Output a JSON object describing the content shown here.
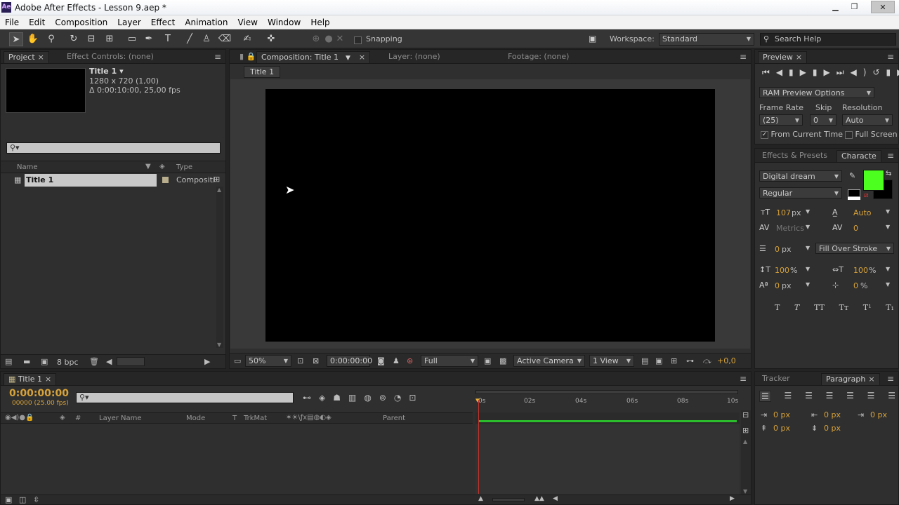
{
  "app": {
    "title": "Adobe After Effects - Lesson 9.aep *",
    "logo_text": "Ae"
  },
  "menu": [
    "File",
    "Edit",
    "Composition",
    "Layer",
    "Effect",
    "Animation",
    "View",
    "Window",
    "Help"
  ],
  "toolbar": {
    "snapping_label": "Snapping",
    "workspace_label": "Workspace:",
    "workspace_value": "Standard",
    "search_placeholder": "Search Help"
  },
  "project_panel": {
    "tab_project": "Project",
    "tab_effect_controls": "Effect Controls: (none)",
    "item_title": "Title 1 ▾",
    "item_dims": "1280 x 720 (1,00)",
    "item_duration": "Δ 0:00:10:00, 25,00 fps",
    "search_icon_text": "⚲▾",
    "col_name": "Name",
    "col_type": "Type",
    "rows": [
      {
        "name": "Title 1",
        "type": "Compositi"
      }
    ],
    "bpc": "8 bpc"
  },
  "comp_panel": {
    "tab_composition": "Composition: Title 1",
    "tab_layer": "Layer: (none)",
    "tab_footage": "Footage: (none)",
    "breadcrumb": "Title 1",
    "zoom": "50%",
    "timecode": "0:00:00:00",
    "quality": "Full",
    "camera": "Active Camera",
    "views": "1 View",
    "exposure": "+0,0"
  },
  "preview_panel": {
    "tab": "Preview",
    "ram_options": "RAM Preview Options",
    "frame_rate_label": "Frame Rate",
    "skip_label": "Skip",
    "resolution_label": "Resolution",
    "frame_rate_value": "(25)",
    "skip_value": "0",
    "resolution_value": "Auto",
    "from_current_time": "From Current Time",
    "full_screen": "Full Screen"
  },
  "character_panel": {
    "tab_effects": "Effects & Presets",
    "tab_character": "Characte",
    "font_family": "Digital dream",
    "font_style": "Regular",
    "font_size": "107",
    "font_size_unit": "px",
    "leading": "Auto",
    "kerning": "Metrics",
    "tracking": "0",
    "stroke_width": "0",
    "stroke_unit": "px",
    "stroke_mode": "Fill Over Stroke",
    "vert_scale": "100",
    "horiz_scale": "100",
    "pct": "%",
    "baseline_shift": "0",
    "baseline_unit": "px",
    "tsume": "0",
    "tsume_unit": "%",
    "fill_color": "#4cff1f",
    "style_buttons": [
      "T",
      "T",
      "TT",
      "Tт",
      "T¹",
      "T₁"
    ]
  },
  "timeline": {
    "tab": "Title 1",
    "timecode": "0:00:00:00",
    "timecode_sub": "00000 (25.00 fps)",
    "search_icon_text": "⚲▾",
    "col_layer_name": "Layer Name",
    "col_mode": "Mode",
    "col_t": "T",
    "col_trkmat": "TrkMat",
    "col_parent": "Parent",
    "ruler": [
      "0s",
      "02s",
      "04s",
      "06s",
      "08s",
      "10s"
    ]
  },
  "paragraph_panel": {
    "tab_tracker": "Tracker",
    "tab_paragraph": "Paragraph",
    "indent_left": "0 px",
    "indent_right": "0 px",
    "indent_first": "0 px",
    "space_before": "0 px",
    "space_after": "0 px"
  }
}
